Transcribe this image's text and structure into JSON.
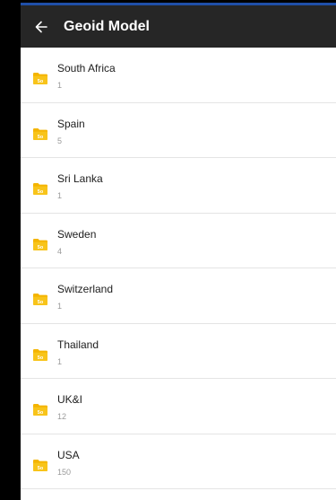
{
  "app_bar": {
    "title": "Geoid Model",
    "back_icon": "arrow-left-icon",
    "background": "#262626"
  },
  "list": {
    "item_icon": "folder-icon",
    "icon_color": "#f4b400",
    "items": [
      {
        "name": "South Africa",
        "count": "1"
      },
      {
        "name": "Spain",
        "count": "5"
      },
      {
        "name": "Sri Lanka",
        "count": "1"
      },
      {
        "name": "Sweden",
        "count": "4"
      },
      {
        "name": "Switzerland",
        "count": "1"
      },
      {
        "name": "Thailand",
        "count": "1"
      },
      {
        "name": "UK&I",
        "count": "12"
      },
      {
        "name": "USA",
        "count": "150"
      }
    ]
  }
}
